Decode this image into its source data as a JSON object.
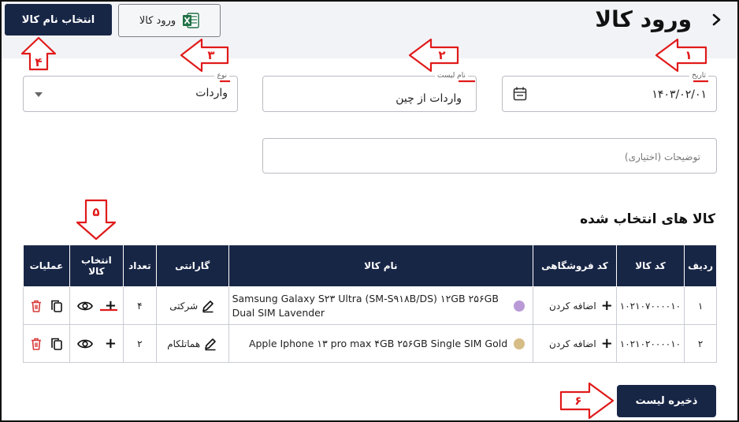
{
  "header": {
    "title": "ورود کالا",
    "select_button": "انتخاب نام کالا",
    "excel_button": "ورود کالا"
  },
  "form": {
    "date": {
      "label": "تاریخ",
      "value": "۱۴۰۳/۰۲/۰۱"
    },
    "list_name": {
      "label": "نام لیست",
      "value": "واردات از چین"
    },
    "type": {
      "label": "نوع",
      "value": "واردات"
    },
    "description": {
      "placeholder": "توضیحات (اختیاری)"
    }
  },
  "selected_goods": {
    "title": "کالا های انتخاب شده",
    "columns": [
      "ردیف",
      "کد کالا",
      "کد فروشگاهی",
      "نام کالا",
      "گارانتی",
      "تعداد",
      "انتخاب کالا",
      "عملیات"
    ],
    "rows": [
      {
        "row": "۱",
        "code": "۱۰۲۱۰۷۰۰۰۰۱۰",
        "store_code": "اضافه کردن",
        "name": "Samsung Galaxy S۲۳ Ultra (SM-S۹۱۸B/DS) ۱۲GB ۲۵۶GB Dual SIM Lavender",
        "color": "#b99ad6",
        "warranty": "شرکتی",
        "qty": "۴"
      },
      {
        "row": "۲",
        "code": "۱۰۲۱۰۲۰۰۰۰۱۰",
        "store_code": "اضافه کردن",
        "name": "Apple Iphone ۱۳ pro max ۴GB ۲۵۶GB Single SIM Gold",
        "color": "#d6bd86",
        "warranty": "هماتلکام",
        "qty": "۲"
      }
    ]
  },
  "save_button": "ذخیره لیست",
  "annotations": {
    "markers": [
      "۱",
      "۲",
      "۳",
      "۴",
      "۵",
      "۶"
    ],
    "color": "#e01a1a"
  }
}
